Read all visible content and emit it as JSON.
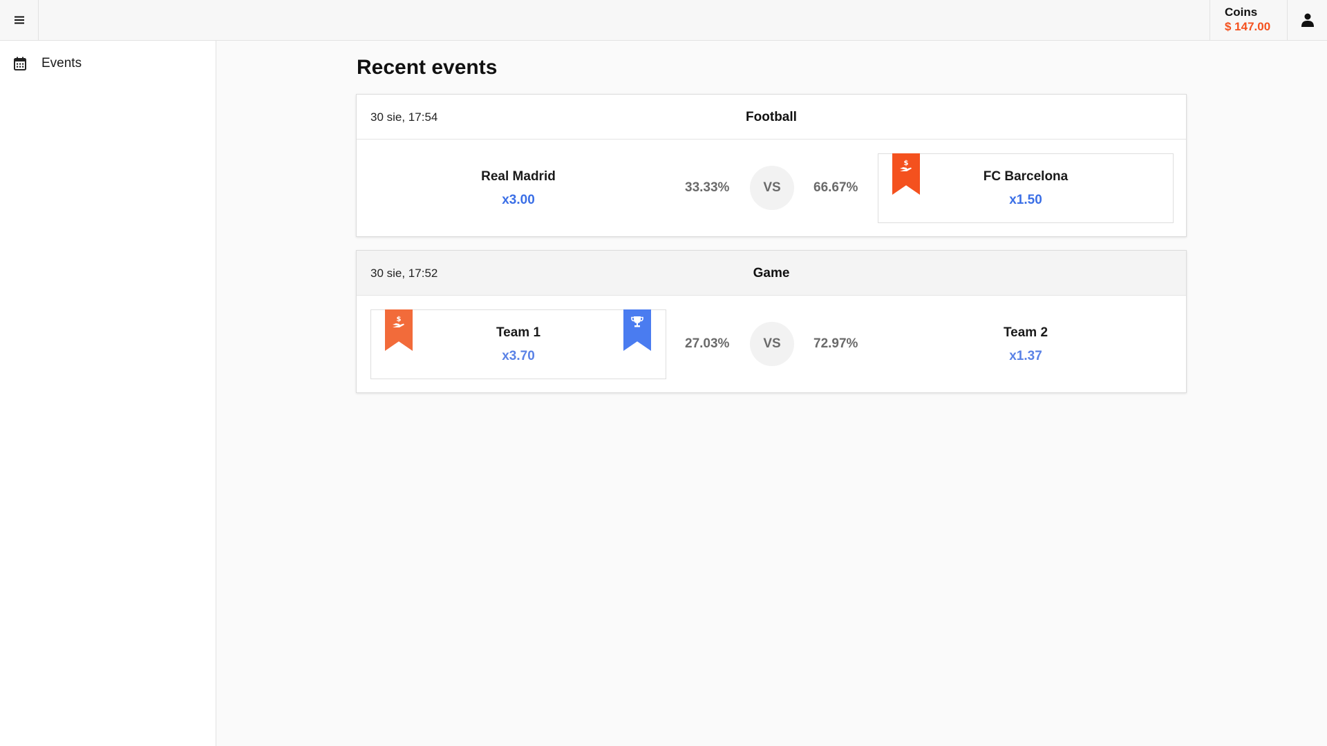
{
  "header": {
    "coins_label": "Coins",
    "coins_value": "$ 147.00",
    "menu_icon": "hamburger-menu-icon",
    "user_icon": "user-icon"
  },
  "sidebar": {
    "items": [
      {
        "label": "Events",
        "icon": "calendar-icon"
      }
    ]
  },
  "main": {
    "title": "Recent events",
    "events": [
      {
        "date": "30 sie, 17:54",
        "category": "Football",
        "vs_label": "VS",
        "left": {
          "name": "Real Madrid",
          "odds": "x3.00",
          "percent": "33.33%"
        },
        "right": {
          "name": "FC Barcelona",
          "odds": "x1.50",
          "percent": "66.67%",
          "badges": [
            "bet-placed"
          ]
        }
      },
      {
        "date": "30 sie, 17:52",
        "category": "Game",
        "vs_label": "VS",
        "left": {
          "name": "Team 1",
          "odds": "x3.70",
          "percent": "27.03%",
          "badges": [
            "bet-placed",
            "winner"
          ]
        },
        "right": {
          "name": "Team 2",
          "odds": "x1.37",
          "percent": "72.97%"
        }
      }
    ]
  },
  "colors": {
    "accent_orange": "#f4511e",
    "accent_orange_light": "#f26b3a",
    "odds_blue": "#3b6fe6",
    "winner_blue": "#4a7cf0",
    "coins_orange": "#f4511e"
  }
}
